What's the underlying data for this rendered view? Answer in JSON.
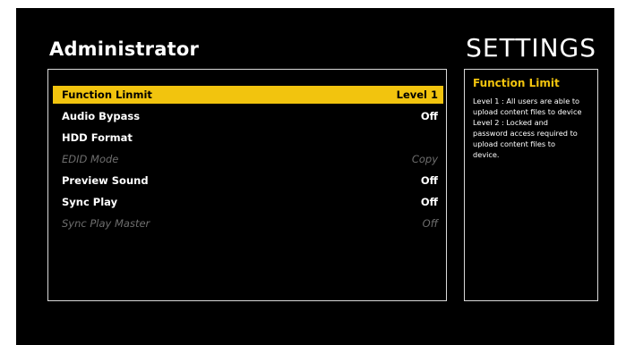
{
  "header": {
    "user": "Administrator",
    "screen_title": "SETTINGS"
  },
  "menu": {
    "items": [
      {
        "label": "Function Linmit",
        "value": "Level 1",
        "state": "selected"
      },
      {
        "label": "Audio Bypass",
        "value": "Off",
        "state": "normal"
      },
      {
        "label": "HDD Format",
        "value": "",
        "state": "normal"
      },
      {
        "label": "EDID Mode",
        "value": "Copy",
        "state": "disabled"
      },
      {
        "label": "Preview Sound",
        "value": "Off",
        "state": "normal"
      },
      {
        "label": "Sync Play",
        "value": "Off",
        "state": "normal"
      },
      {
        "label": "Sync Play Master",
        "value": "Off",
        "state": "disabled"
      }
    ]
  },
  "info": {
    "title": "Function Limit",
    "lines": [
      "Level 1 : All users are able to",
      "upload content files to device",
      "Level 2 : Locked and",
      "password access required to",
      "upload content files to",
      "device."
    ]
  },
  "colors": {
    "background": "#000000",
    "highlight": "#f2c40e",
    "text": "#ffffff",
    "disabled_text": "#6e6e6e",
    "border": "#d9d9d9"
  }
}
